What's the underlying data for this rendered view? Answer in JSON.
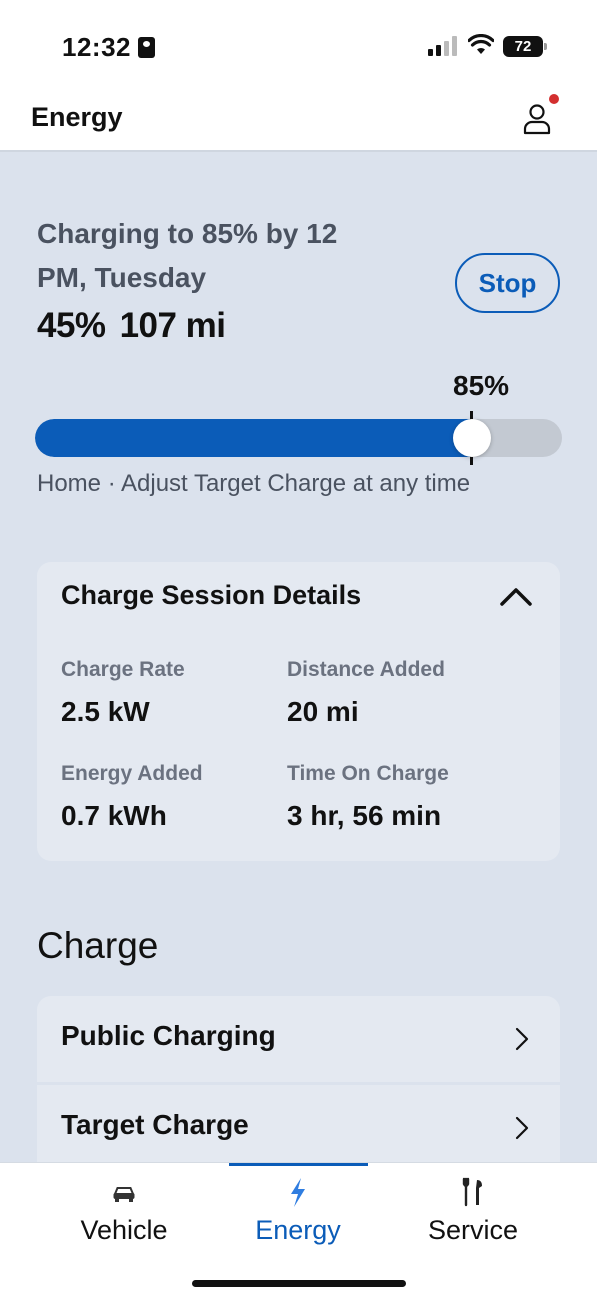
{
  "status_bar": {
    "time": "12:32",
    "battery": "72"
  },
  "header": {
    "title": "Energy"
  },
  "charging": {
    "status": "Charging to 85% by 12 PM, Tuesday",
    "battery_percent": "45%",
    "range": "107 mi",
    "stop_label": "Stop",
    "target_label": "85%",
    "current_level": 0.45,
    "target_level": 0.85,
    "location_note": "Home · Adjust Target Charge at any time"
  },
  "session_details": {
    "title": "Charge Session Details",
    "items": [
      {
        "label": "Charge Rate",
        "value": "2.5 kW"
      },
      {
        "label": "Distance Added",
        "value": "20 mi"
      },
      {
        "label": "Energy Added",
        "value": "0.7 kWh"
      },
      {
        "label": "Time On Charge",
        "value": "3 hr, 56 min"
      }
    ]
  },
  "charge_section": {
    "title": "Charge",
    "items": [
      {
        "label": "Public Charging"
      },
      {
        "label": "Target Charge"
      }
    ]
  },
  "tabs": [
    {
      "label": "Vehicle",
      "icon": "car-icon",
      "active": false
    },
    {
      "label": "Energy",
      "icon": "lightning-icon",
      "active": true
    },
    {
      "label": "Service",
      "icon": "tools-icon",
      "active": false
    }
  ],
  "colors": {
    "accent": "#0b5cb8",
    "background": "#dbe2ed",
    "card": "#e4e9f1",
    "notification": "#d32f2f"
  }
}
